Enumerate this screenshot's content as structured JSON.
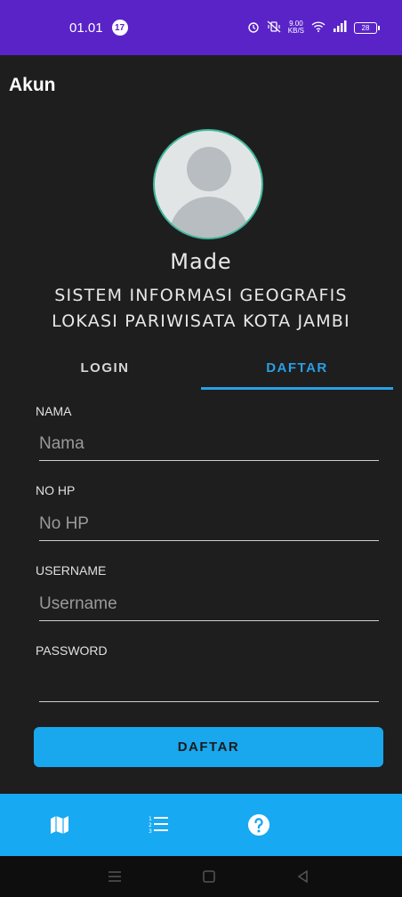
{
  "status_bar": {
    "time": "01.01",
    "notification_count": "17",
    "net_speed_value": "9.00",
    "net_speed_unit": "KB/S",
    "battery": "28"
  },
  "header": {
    "title": "Akun"
  },
  "profile": {
    "name": "Made",
    "app_desc_line1": "SISTEM INFORMASI GEOGRAFIS",
    "app_desc_line2": "LOKASI PARIWISATA KOTA JAMBI"
  },
  "tabs": [
    {
      "label": "LOGIN",
      "active": false
    },
    {
      "label": "DAFTAR",
      "active": true
    }
  ],
  "form": {
    "nama": {
      "label": "NAMA",
      "placeholder": "Nama",
      "value": ""
    },
    "nohp": {
      "label": "NO HP",
      "placeholder": "No HP",
      "value": ""
    },
    "username": {
      "label": "USERNAME",
      "placeholder": "Username",
      "value": ""
    },
    "password": {
      "label": "PASSWORD",
      "placeholder": "",
      "value": ""
    },
    "submit_label": "DAFTAR"
  },
  "bottom_nav": {
    "items": [
      {
        "icon": "map-icon",
        "active": true
      },
      {
        "icon": "list-icon",
        "active": false
      },
      {
        "icon": "help-icon",
        "active": false
      }
    ]
  },
  "colors": {
    "status_bar": "#5a23c8",
    "accent": "#2a9fe6",
    "button": "#19a8ee",
    "bottom_nav": "#17a9f1",
    "background": "#1e1e1e"
  }
}
